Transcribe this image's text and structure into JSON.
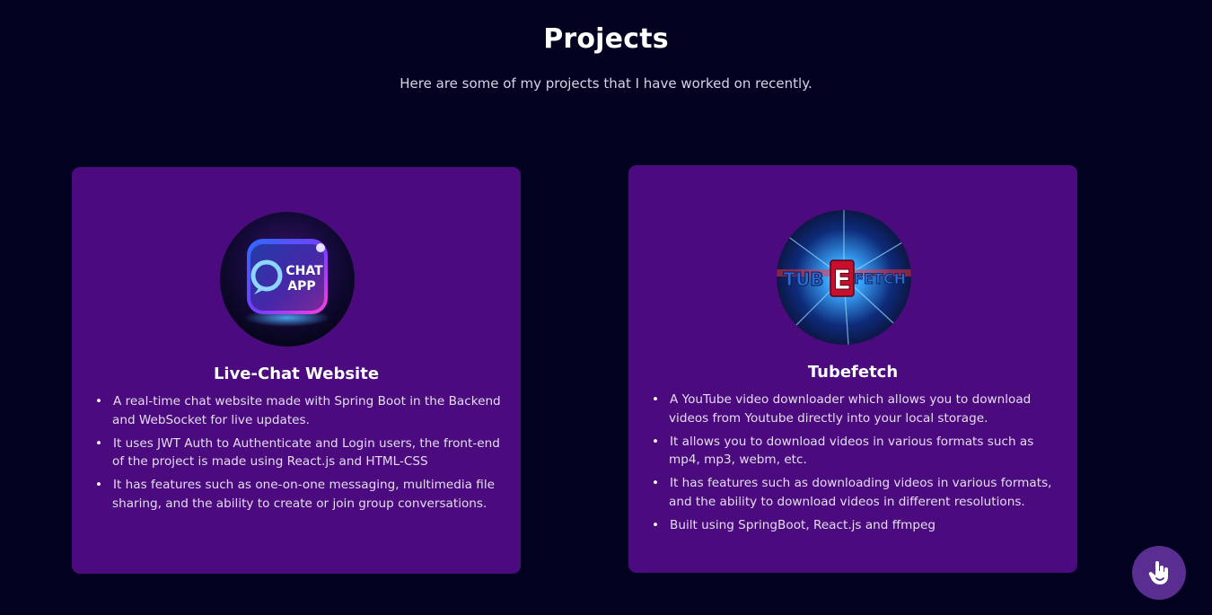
{
  "header": {
    "title": "Projects",
    "subtitle": "Here are some of my projects that I have worked on recently."
  },
  "projects": [
    {
      "title": "Live-Chat Website",
      "logo_text": [
        "CHAT",
        "APP"
      ],
      "points": [
        "A real-time chat website made with Spring Boot in the Backend and WebSocket for live updates.",
        "It uses JWT Auth to Authenticate and Login users, the front-end of the project is made using React.js and HTML-CSS",
        "It has features such as one-on-one messaging, multimedia file sharing, and the ability to create or join group conversations."
      ]
    },
    {
      "title": "Tubefetch",
      "logo_text": [
        "TUB",
        "E",
        "FETCH"
      ],
      "points": [
        "A YouTube video downloader which allows you to download videos from Youtube directly into your local storage.",
        "It allows you to download videos in various formats such as mp4, mp3, webm, etc.",
        "It has features such as downloading videos in various formats, and the ability to download videos in different resolutions.",
        "Built using SpringBoot, React.js and ffmpeg"
      ]
    }
  ],
  "colors": {
    "background": "#020220",
    "card": "#4b0b7e",
    "help_button": "#5a2d91"
  },
  "icons": {
    "help_button": "hand-pointer-icon"
  }
}
